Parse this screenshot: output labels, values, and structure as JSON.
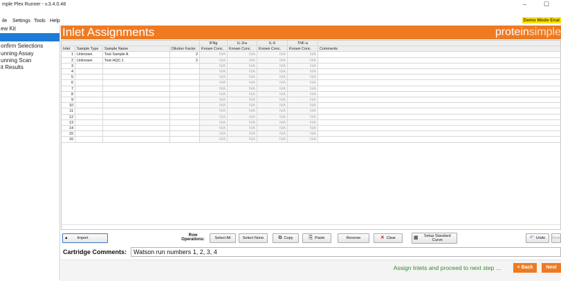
{
  "window": {
    "title": "mple Plex Runner - v.3.4.0.48",
    "minimize": "–",
    "maximize": "☐"
  },
  "menu": {
    "items": [
      "ile",
      "Settings",
      "Tools",
      "Help"
    ]
  },
  "demo_badge": "Demo Mode Enal",
  "sidebar": {
    "items": [
      "ew Kit",
      "",
      "onfirm Selections",
      "unning Assay",
      "unning Scan",
      "it Results"
    ],
    "active_index": 1
  },
  "header": {
    "title": "Inlet Assignments",
    "logo_bold": "protein",
    "logo_light": "simple"
  },
  "grid": {
    "group_headers": [
      "IFNg",
      "IL-2ra",
      "IL-6",
      "TNF-a"
    ],
    "columns": [
      "Inlet",
      "Sample Type",
      "Sample Name",
      "Dilution Factor",
      "Known Conc.",
      "Known Conc.",
      "Known Conc.",
      "Known Conc.",
      "Comments"
    ],
    "na_text": "N/A",
    "rows": [
      {
        "inlet": "1",
        "type": "Unknown",
        "name": "Test Sample A",
        "dilution": "2"
      },
      {
        "inlet": "2",
        "type": "Unknown",
        "name": "Test HQC.1",
        "dilution": "2"
      },
      {
        "inlet": "3",
        "type": "",
        "name": "",
        "dilution": ""
      },
      {
        "inlet": "4",
        "type": "",
        "name": "",
        "dilution": ""
      },
      {
        "inlet": "5",
        "type": "",
        "name": "",
        "dilution": ""
      },
      {
        "inlet": "6",
        "type": "",
        "name": "",
        "dilution": ""
      },
      {
        "inlet": "7",
        "type": "",
        "name": "",
        "dilution": ""
      },
      {
        "inlet": "8",
        "type": "",
        "name": "",
        "dilution": ""
      },
      {
        "inlet": "9",
        "type": "",
        "name": "",
        "dilution": ""
      },
      {
        "inlet": "10",
        "type": "",
        "name": "",
        "dilution": ""
      },
      {
        "inlet": "11",
        "type": "",
        "name": "",
        "dilution": ""
      },
      {
        "inlet": "12",
        "type": "",
        "name": "",
        "dilution": ""
      },
      {
        "inlet": "13",
        "type": "",
        "name": "",
        "dilution": ""
      },
      {
        "inlet": "14",
        "type": "",
        "name": "",
        "dilution": ""
      },
      {
        "inlet": "15",
        "type": "",
        "name": "",
        "dilution": ""
      },
      {
        "inlet": "16",
        "type": "",
        "name": "",
        "dilution": ""
      }
    ]
  },
  "toolbar": {
    "import": "Import",
    "row_ops_1": "Row",
    "row_ops_2": "Operations:",
    "select_all": "Select All",
    "select_none": "Select None",
    "copy": "Copy",
    "paste": "Paste",
    "reverse": "Reverse",
    "clear": "Clear",
    "setup_1": "Setup Standard",
    "setup_2": "Curve",
    "undo": "Undo",
    "redo": "Redo"
  },
  "comments": {
    "label": "Cartridge Comments:",
    "value": "Watson run numbers 1, 2, 3, 4"
  },
  "footer": {
    "message": "Assign Inlets and proceed to next step ...",
    "back": "< Back",
    "next": "Next"
  },
  "colors": {
    "accent": "#ef7a22",
    "sidebar_active": "#1f7bd6",
    "footer_text": "#2a8c2a",
    "demo_badge": "#f3e600"
  }
}
